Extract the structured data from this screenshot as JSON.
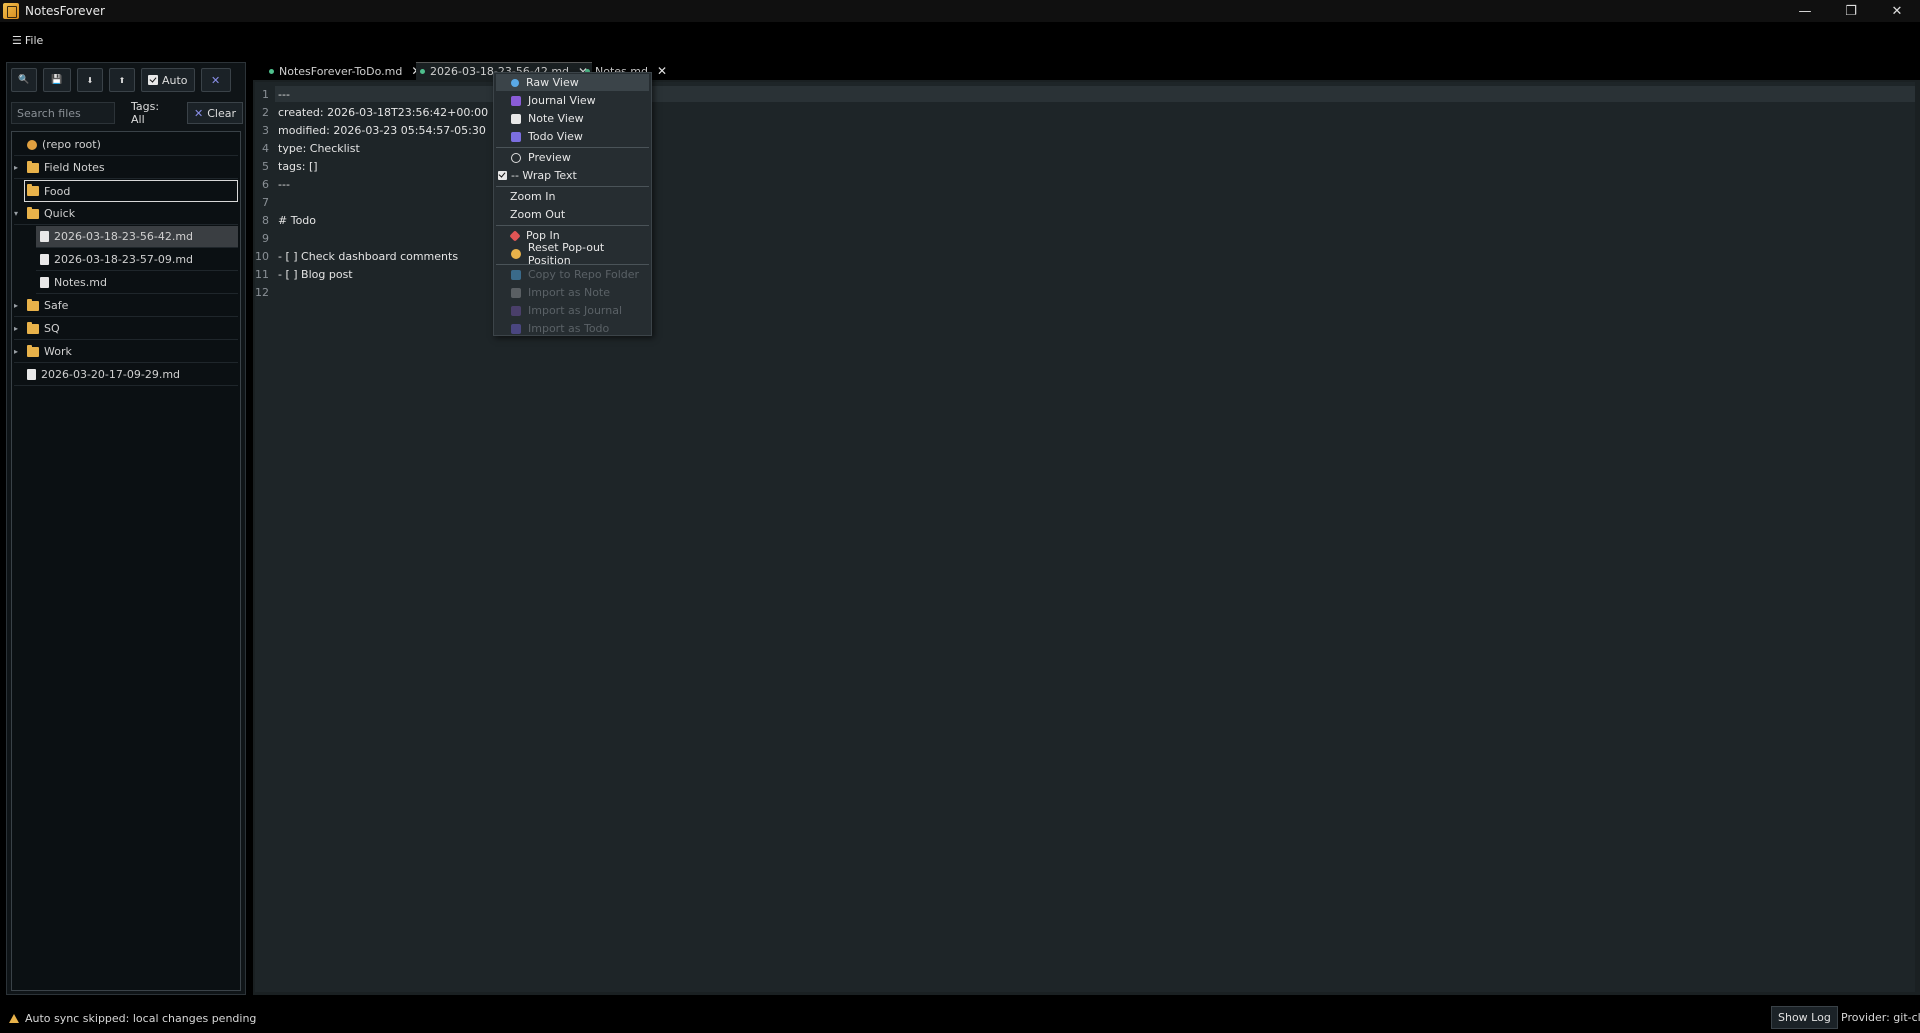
{
  "window": {
    "title": "NotesForever",
    "min": "—",
    "max": "❐",
    "close": "✕"
  },
  "menu": {
    "file_label": "File",
    "hamburger": "☰"
  },
  "toolbar": {
    "search_icon": "🔍",
    "save_icon": "💾",
    "down_label": "⬇",
    "up_label": "⬆",
    "auto_label": "Auto",
    "close_label": "✕"
  },
  "filter": {
    "search_placeholder": "Search files",
    "tags_label": "Tags: All",
    "clear_label": "Clear",
    "clear_icon": "✕"
  },
  "tree": [
    {
      "label": "(repo root)",
      "kind": "repo",
      "indent": 0
    },
    {
      "label": "Field Notes",
      "kind": "folder",
      "indent": 0,
      "expanded": false
    },
    {
      "label": "Food",
      "kind": "folder",
      "indent": 0,
      "expanded": false,
      "focused": true
    },
    {
      "label": "Quick",
      "kind": "folder",
      "indent": 0,
      "expanded": true
    },
    {
      "label": "2026-03-18-23-56-42.md",
      "kind": "file",
      "indent": 1,
      "selected": true
    },
    {
      "label": "2026-03-18-23-57-09.md",
      "kind": "file",
      "indent": 1
    },
    {
      "label": "Notes.md",
      "kind": "file",
      "indent": 1
    },
    {
      "label": "Safe",
      "kind": "folder",
      "indent": 0,
      "expanded": false
    },
    {
      "label": "SQ",
      "kind": "folder",
      "indent": 0,
      "expanded": false
    },
    {
      "label": "Work",
      "kind": "folder",
      "indent": 0,
      "expanded": false
    },
    {
      "label": "2026-03-20-17-09-29.md",
      "kind": "file",
      "indent": 0
    }
  ],
  "tabs": [
    {
      "label": "NotesForever-ToDo.md",
      "close": "✕"
    },
    {
      "label": "2026-03-18-23-56-42.md",
      "close": "✕",
      "active": true
    },
    {
      "label": "Notes.md",
      "close": "✕"
    }
  ],
  "editor_lines": [
    {
      "n": "1",
      "text": "---"
    },
    {
      "n": "2",
      "text": "created: 2026-03-18T23:56:42+00:00"
    },
    {
      "n": "3",
      "text": "modified: 2026-03-23 05:54:57-05:30"
    },
    {
      "n": "4",
      "text": "type: Checklist"
    },
    {
      "n": "5",
      "text": "tags: []"
    },
    {
      "n": "6",
      "text": "---"
    },
    {
      "n": "7",
      "text": ""
    },
    {
      "n": "8",
      "text": "# Todo"
    },
    {
      "n": "9",
      "text": ""
    },
    {
      "n": "10",
      "text": "- [ ] Check dashboard comments"
    },
    {
      "n": "11",
      "text": "- [ ] Blog post"
    },
    {
      "n": "12",
      "text": ""
    }
  ],
  "context_menu": {
    "raw_view": "Raw View",
    "journal_view": "Journal View",
    "note_view": "Note View",
    "todo_view": "Todo View",
    "preview": "Preview",
    "wrap_text": "-- Wrap Text",
    "zoom_in": "Zoom In",
    "zoom_out": "Zoom Out",
    "pop_in": "Pop In",
    "reset_popout": "Reset Pop-out Position",
    "copy_to_repo": "Copy to Repo Folder",
    "import_note": "Import as Note",
    "import_journal": "Import as Journal",
    "import_todo": "Import as Todo"
  },
  "status": {
    "message": "Auto sync skipped: local changes pending",
    "show_log": "Show Log",
    "provider": "Provider: git-cli"
  },
  "colors": {
    "accent_folder": "#e8b24a",
    "tab_dot": "#4fc08d",
    "warning": "#e8b24a"
  }
}
